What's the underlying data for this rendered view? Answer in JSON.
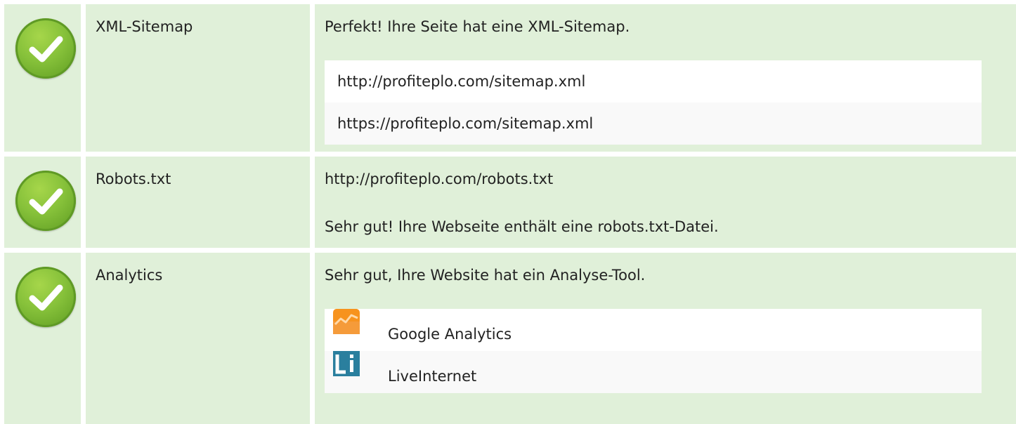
{
  "rows": [
    {
      "label": "XML-Sitemap",
      "message": "Perfekt! Ihre Seite hat eine XML-Sitemap.",
      "sitemaps": [
        "http://profiteplo.com/sitemap.xml",
        "https://profiteplo.com/sitemap.xml"
      ],
      "status_icon": "check-circle-icon"
    },
    {
      "label": "Robots.txt",
      "url": "http://profiteplo.com/robots.txt",
      "message": "Sehr gut! Ihre Webseite enthält eine robots.txt-Datei.",
      "status_icon": "check-circle-icon"
    },
    {
      "label": "Analytics",
      "message": "Sehr gut, Ihre Website hat ein Analyse-Tool.",
      "tools": [
        {
          "name": "Google Analytics",
          "icon": "google-analytics-icon"
        },
        {
          "name": "LiveInternet",
          "icon": "liveinternet-icon"
        }
      ],
      "status_icon": "check-circle-icon"
    }
  ],
  "colors": {
    "row_background": "#e0f0d9",
    "check_green": "#86c13a",
    "ga_orange": "#f7931e",
    "li_blue": "#2a7f9e"
  }
}
